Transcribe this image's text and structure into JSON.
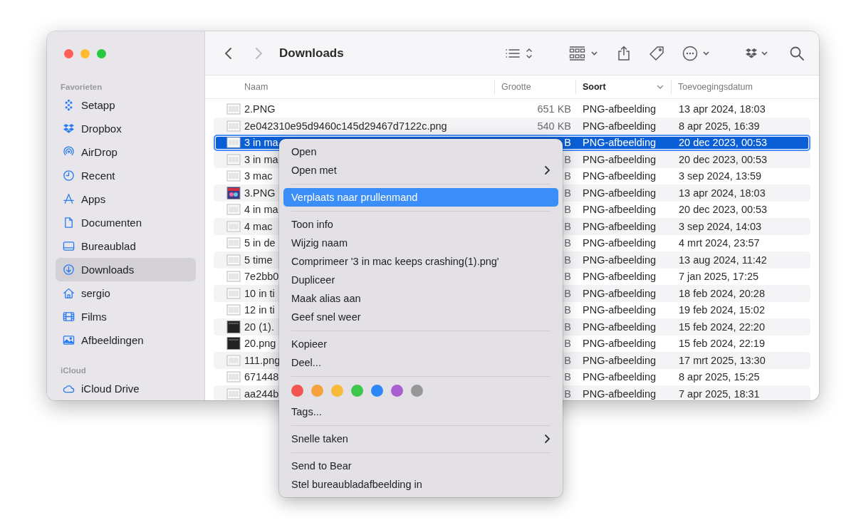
{
  "window": {
    "title": "Downloads"
  },
  "toolbar": {
    "back": {
      "disabled": false
    },
    "forward": {
      "disabled": true
    }
  },
  "sidebar": {
    "sections": [
      {
        "heading": "Favorieten",
        "items": [
          {
            "label": "Setapp",
            "kind": "setapp",
            "selected": false
          },
          {
            "label": "Dropbox",
            "kind": "dropbox",
            "selected": false
          },
          {
            "label": "AirDrop",
            "kind": "airdrop",
            "selected": false
          },
          {
            "label": "Recent",
            "kind": "clock",
            "selected": false
          },
          {
            "label": "Apps",
            "kind": "apps",
            "selected": false
          },
          {
            "label": "Documenten",
            "kind": "document",
            "selected": false
          },
          {
            "label": "Bureaublad",
            "kind": "desktop",
            "selected": false
          },
          {
            "label": "Downloads",
            "kind": "download",
            "selected": true
          },
          {
            "label": "sergio",
            "kind": "home",
            "selected": false
          },
          {
            "label": "Films",
            "kind": "film",
            "selected": false
          },
          {
            "label": "Afbeeldingen",
            "kind": "photo",
            "selected": false
          }
        ]
      },
      {
        "heading": "iCloud",
        "items": [
          {
            "label": "iCloud Drive",
            "kind": "cloud",
            "selected": false
          }
        ]
      }
    ]
  },
  "table": {
    "columns": [
      {
        "label": "Naam",
        "sorted": false
      },
      {
        "label": "Grootte",
        "sorted": false
      },
      {
        "label": "Soort",
        "sorted": true
      },
      {
        "label": "Toevoegingsdatum",
        "sorted": false
      }
    ],
    "rows": [
      {
        "name": "2.PNG",
        "size": "651 KB",
        "type": "PNG-afbeelding",
        "date": "13 apr 2024, 18:03",
        "kind": "light",
        "selected": false
      },
      {
        "name": "2e042310e95d9460c145d29467d7122c.png",
        "size": "540 KB",
        "type": "PNG-afbeelding",
        "date": "8 apr 2025, 16:39",
        "kind": "light",
        "selected": false
      },
      {
        "name": "3 in ma",
        "size": "B",
        "type": "PNG-afbeelding",
        "date": "20 dec 2023, 00:53",
        "kind": "light",
        "selected": true
      },
      {
        "name": "3 in ma",
        "size": "B",
        "type": "PNG-afbeelding",
        "date": "20 dec 2023, 00:53",
        "kind": "light",
        "selected": false
      },
      {
        "name": "3 mac",
        "size": "B",
        "type": "PNG-afbeelding",
        "date": "3 sep 2024, 13:59",
        "kind": "light",
        "selected": false
      },
      {
        "name": "3.PNG",
        "size": "B",
        "type": "PNG-afbeelding",
        "date": "13 apr 2024, 18:03",
        "kind": "color",
        "selected": false
      },
      {
        "name": "4 in ma",
        "size": "B",
        "type": "PNG-afbeelding",
        "date": "20 dec 2023, 00:53",
        "kind": "light",
        "selected": false
      },
      {
        "name": "4 mac",
        "size": "B",
        "type": "PNG-afbeelding",
        "date": "3 sep 2024, 14:03",
        "kind": "light",
        "selected": false
      },
      {
        "name": "5 in de",
        "size": "B",
        "type": "PNG-afbeelding",
        "date": "4 mrt 2024, 23:57",
        "kind": "light",
        "selected": false
      },
      {
        "name": "5 time",
        "size": "B",
        "type": "PNG-afbeelding",
        "date": "13 aug 2024, 11:42",
        "kind": "light",
        "selected": false
      },
      {
        "name": "7e2bb0",
        "size": "B",
        "type": "PNG-afbeelding",
        "date": "7 jan 2025, 17:25",
        "kind": "light",
        "selected": false
      },
      {
        "name": "10 in ti",
        "size": "B",
        "type": "PNG-afbeelding",
        "date": "18 feb 2024, 20:28",
        "kind": "light",
        "selected": false
      },
      {
        "name": "12 in ti",
        "size": "B",
        "type": "PNG-afbeelding",
        "date": "19 feb 2024, 15:02",
        "kind": "light",
        "selected": false
      },
      {
        "name": "20 (1).",
        "size": "B",
        "type": "PNG-afbeelding",
        "date": "15 feb 2024, 22:20",
        "kind": "dark",
        "selected": false
      },
      {
        "name": "20.png",
        "size": "B",
        "type": "PNG-afbeelding",
        "date": "15 feb 2024, 22:19",
        "kind": "dark",
        "selected": false
      },
      {
        "name": "111.png",
        "size": "B",
        "type": "PNG-afbeelding",
        "date": "17 mrt 2025, 13:30",
        "kind": "light",
        "selected": false
      },
      {
        "name": "671448",
        "size": "B",
        "type": "PNG-afbeelding",
        "date": "8 apr 2025, 15:25",
        "kind": "light",
        "selected": false
      },
      {
        "name": "aa244b",
        "size": "B",
        "type": "PNG-afbeelding",
        "date": "7 apr 2025, 18:31",
        "kind": "light",
        "selected": false
      }
    ]
  },
  "menu": {
    "items": [
      {
        "kind": "item",
        "label": "Open",
        "submenu": false,
        "selected": false
      },
      {
        "kind": "item",
        "label": "Open met",
        "submenu": true,
        "selected": false
      },
      {
        "kind": "separator"
      },
      {
        "kind": "item",
        "label": "Verplaats naar prullenmand",
        "submenu": false,
        "selected": true
      },
      {
        "kind": "separator"
      },
      {
        "kind": "item",
        "label": "Toon info",
        "submenu": false,
        "selected": false
      },
      {
        "kind": "item",
        "label": "Wijzig naam",
        "submenu": false,
        "selected": false
      },
      {
        "kind": "item",
        "label": "Comprimeer '3 in mac keeps crashing(1).png'",
        "submenu": false,
        "selected": false
      },
      {
        "kind": "item",
        "label": "Dupliceer",
        "submenu": false,
        "selected": false
      },
      {
        "kind": "item",
        "label": "Maak alias aan",
        "submenu": false,
        "selected": false
      },
      {
        "kind": "item",
        "label": "Geef snel weer",
        "submenu": false,
        "selected": false
      },
      {
        "kind": "separator"
      },
      {
        "kind": "item",
        "label": "Kopieer",
        "submenu": false,
        "selected": false
      },
      {
        "kind": "item",
        "label": "Deel...",
        "submenu": false,
        "selected": false
      },
      {
        "kind": "separator"
      },
      {
        "kind": "colors",
        "tags": [
          {
            "color": "#f25550"
          },
          {
            "color": "#f7a13c"
          },
          {
            "color": "#f9b93b"
          },
          {
            "color": "#3fc74c"
          },
          {
            "color": "#2f86f6"
          },
          {
            "color": "#a95fd0"
          },
          {
            "color": "#979797"
          }
        ]
      },
      {
        "kind": "item",
        "label": "Tags...",
        "submenu": false,
        "selected": false
      },
      {
        "kind": "separator"
      },
      {
        "kind": "item",
        "label": "Snelle taken",
        "submenu": true,
        "selected": false
      },
      {
        "kind": "separator"
      },
      {
        "kind": "item",
        "label": "Send to Bear",
        "submenu": false,
        "selected": false
      },
      {
        "kind": "item",
        "label": "Stel bureaubladafbeelding in",
        "submenu": false,
        "selected": false
      }
    ]
  }
}
